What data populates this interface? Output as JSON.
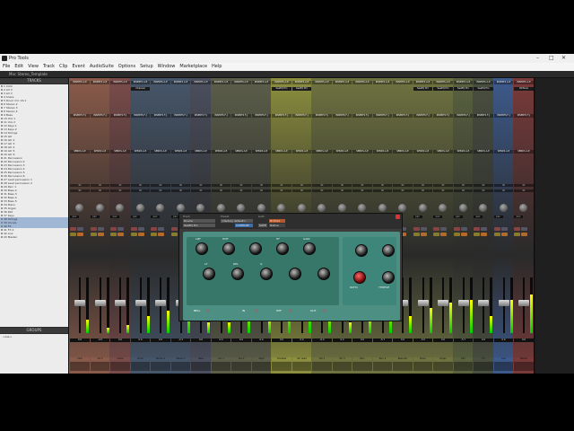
{
  "window": {
    "title": "Pro Tools",
    "mix_window_label": "Mix: Stereo_Template"
  },
  "menu": [
    "File",
    "Edit",
    "View",
    "Track",
    "Clip",
    "Event",
    "AudioSuite",
    "Options",
    "Setup",
    "Window",
    "Marketplace",
    "Help"
  ],
  "sidebar": {
    "tracks_header": "TRACKS",
    "groups_header": "GROUPS",
    "groups_item": "<ALL>",
    "tracks": [
      "1 Click",
      "2 LD V",
      "3 LD V",
      "4 Snare",
      "5 Drum mic 16.1",
      "6 Stereo 2",
      "7 Stereo 3",
      "8 Stereo 4",
      "9 Bass",
      "10 Vox 1",
      "11 Vox 2",
      "12 Keys 1",
      "13 Keys 2",
      "14 Strings",
      "15 Gtr",
      "16 Gtr 2",
      "17 Gtr 3",
      "18 Gtr 4",
      "19 Gtr 5",
      "20 Gtr 6",
      "21 Percussion",
      "22 Percussion 2",
      "23 Percussion 3",
      "24 Percussion 4",
      "25 Percussion 5",
      "26 Percussion 6",
      "27 Lead percussion 1",
      "28 Lead percussion 2",
      "29 Perc 1",
      "30 Bass 2",
      "31 Bass 3",
      "32 Bass 4",
      "33 Bass 5",
      "34 Piano",
      "35 Organ",
      "36 Pad",
      "37 Keys",
      "38 Strings",
      "39 Vocals",
      "40 FX",
      "41 FX 2",
      "42 Aux",
      "43 Master"
    ],
    "selected_indices": [
      37,
      38,
      39
    ]
  },
  "mixer": {
    "insert_label": "INSERTS A-E",
    "insert_label2": "INSERTS F-J",
    "sends_label": "SENDS A-E",
    "io_label": "IO",
    "pan_label": "pan",
    "plugin_slots": [
      {
        "strip": 3,
        "label": "Channel"
      },
      {
        "strip": 10,
        "label": "SeeEQ Pro"
      },
      {
        "strip": 11,
        "label": "SeeEQ Pro"
      },
      {
        "strip": 17,
        "label": "SeeEQ Pro"
      },
      {
        "strip": 18,
        "label": "SeeEQ Pro"
      },
      {
        "strip": 19,
        "label": "SeeEQ Pro"
      },
      {
        "strip": 20,
        "label": "SeeEQ Pro"
      },
      {
        "strip": 22,
        "label": "RCTools"
      }
    ],
    "strips": [
      {
        "name": "Click",
        "color": "#8a5b4a",
        "meter": 0.25,
        "fader": 0.55,
        "vol": "0.0"
      },
      {
        "name": "LD V",
        "color": "#8a5b4a",
        "meter": 0.1,
        "fader": 0.55,
        "vol": "-4.5"
      },
      {
        "name": "Snare",
        "color": "#7a4c4a",
        "meter": 0.15,
        "fader": 0.55,
        "vol": "0.0"
      },
      {
        "name": "Drum",
        "color": "#46566a",
        "meter": 0.3,
        "fader": 0.55,
        "vol": "0.0"
      },
      {
        "name": "Stereo 2",
        "color": "#46566a",
        "meter": 0.4,
        "fader": 0.55,
        "vol": "0.0"
      },
      {
        "name": "Stereo 3",
        "color": "#46566a",
        "meter": 0.6,
        "fader": 0.55,
        "vol": "-2.3"
      },
      {
        "name": "Bass",
        "color": "#4b4f5e",
        "meter": 0.2,
        "fader": 0.55,
        "vol": "0.0"
      },
      {
        "name": "Vox 1",
        "color": "#5c5e4a",
        "meter": 0.2,
        "fader": 0.55,
        "vol": "0.0"
      },
      {
        "name": "Vox 2",
        "color": "#5c5e4a",
        "meter": 0.5,
        "fader": 0.55,
        "vol": "0.0"
      },
      {
        "name": "Keys",
        "color": "#5c5e4a",
        "meter": 0.3,
        "fader": 0.55,
        "vol": "0.0"
      },
      {
        "name": "Doubles",
        "color": "#8c8f3e",
        "meter": 0.6,
        "fader": 0.55,
        "vol": "0.0"
      },
      {
        "name": "Gtr Lead",
        "color": "#8c8f3e",
        "meter": 0.7,
        "fader": 0.55,
        "vol": "0.0"
      },
      {
        "name": "Gtr 2",
        "color": "#6f7340",
        "meter": 0.4,
        "fader": 0.55,
        "vol": "-6.0"
      },
      {
        "name": "Gtr 3",
        "color": "#6f7340",
        "meter": 0.2,
        "fader": 0.55,
        "vol": "0.0"
      },
      {
        "name": "Perc",
        "color": "#6f7340",
        "meter": 0.35,
        "fader": 0.55,
        "vol": "0.0"
      },
      {
        "name": "Perc 2",
        "color": "#6f7340",
        "meter": 0.5,
        "fader": 0.55,
        "vol": "-5.7"
      },
      {
        "name": "Bass Gtr",
        "color": "#6f7340",
        "meter": 0.3,
        "fader": 0.55,
        "vol": "0.0"
      },
      {
        "name": "Piano",
        "color": "#6f7340",
        "meter": 0.45,
        "fader": 0.55,
        "vol": "-5.0"
      },
      {
        "name": "Organ",
        "color": "#6f7340",
        "meter": 0.55,
        "fader": 0.55,
        "vol": "0.0"
      },
      {
        "name": "Pad",
        "color": "#5a6340",
        "meter": 0.6,
        "fader": 0.55,
        "vol": "-5.7"
      },
      {
        "name": "FX",
        "color": "#4a5040",
        "meter": 0.3,
        "fader": 0.55,
        "vol": "0.0"
      },
      {
        "name": "Aux",
        "color": "#3d5a8c",
        "meter": 0.6,
        "fader": 0.55,
        "vol": "0.0"
      },
      {
        "name": "Master",
        "color": "#7a3a3a",
        "meter": 0.7,
        "fader": 0.55,
        "vol": "0.0"
      }
    ]
  },
  "plugin": {
    "track_label": "Track",
    "preset_label": "Preset",
    "auto_label": "Auto",
    "track_value": "Drums",
    "plugin_name": "SeeEQ Pro",
    "preset_value": "<factory default>",
    "compare": "COMPARE",
    "bypass": "BYPASS",
    "safe": "SAFE",
    "native": "Native",
    "knob_labels": [
      "LMF",
      "HMF",
      "HF",
      "LF",
      "GAIN",
      "Q",
      "RATIO",
      "THRESH",
      "REL"
    ],
    "bottom_labels": [
      "BELL",
      "IN",
      "HPF",
      "OUT"
    ],
    "accent": "#4d8f82"
  }
}
